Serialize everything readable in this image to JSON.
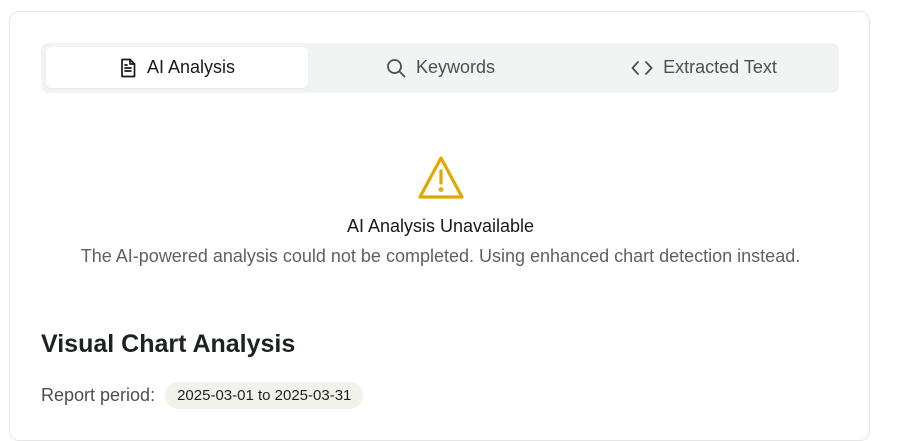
{
  "tabs": [
    {
      "label": "AI Analysis",
      "icon": "document-icon",
      "active": true
    },
    {
      "label": "Keywords",
      "icon": "search-icon",
      "active": false
    },
    {
      "label": "Extracted Text",
      "icon": "code-icon",
      "active": false
    }
  ],
  "alert": {
    "icon": "warning-icon",
    "color": "#e0a800",
    "title": "AI Analysis Unavailable",
    "message": "The AI-powered analysis could not be completed. Using enhanced chart detection instead."
  },
  "section": {
    "title": "Visual Chart Analysis",
    "period_label": "Report period:",
    "period_value": "2025-03-01 to 2025-03-31"
  }
}
